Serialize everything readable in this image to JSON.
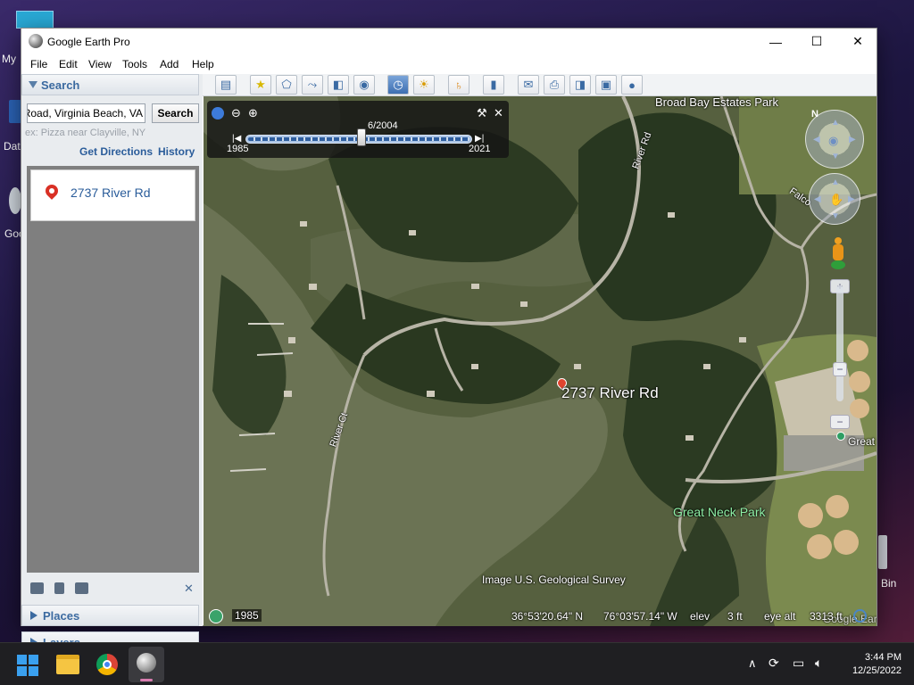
{
  "desktop": {
    "icon_labels": [
      "My",
      "Dat",
      "Goo",
      "Bin"
    ]
  },
  "window": {
    "title": "Google Earth Pro",
    "controls": {
      "minimize": "—",
      "maximize": "☐",
      "close": "✕"
    }
  },
  "menu": [
    "File",
    "Edit",
    "View",
    "Tools",
    "Add",
    "Help"
  ],
  "search_panel": {
    "header": "Search",
    "input_value": "er Road, Virginia Beach, VA",
    "search_button": "Search",
    "hint": "ex: Pizza near Clayville, NY",
    "get_directions": "Get Directions",
    "history": "History",
    "results": [
      {
        "label": "2737 River Rd"
      }
    ],
    "close_panel": "✕"
  },
  "sections": {
    "places": "Places",
    "layers": "Layers"
  },
  "time_slider": {
    "current_date": "6/2004",
    "start_year": "1985",
    "end_year": "2021",
    "position_fraction": 0.51
  },
  "map": {
    "labels": {
      "broad_bay": "Broad Bay Estates Park",
      "river_rd": "River Rd",
      "river_ct": "River Ct",
      "falcon": "Falco",
      "placemark": "2737 River Rd",
      "great_neck_school": "Great Nec",
      "great_neck_park": "Great Neck Park",
      "credit": "Image U.S. Geological Survey",
      "watermark": "Google Earth"
    },
    "status": {
      "imagery_year": "1985",
      "latitude": "36°53'20.64\" N",
      "longitude": "76°03'57.14\" W",
      "elev_label": "elev",
      "elev_value": "3 ft",
      "eye_alt_label": "eye alt",
      "eye_alt_value": "3313 ft"
    }
  },
  "taskbar": {
    "time": "3:44 PM",
    "date": "12/25/2022"
  }
}
